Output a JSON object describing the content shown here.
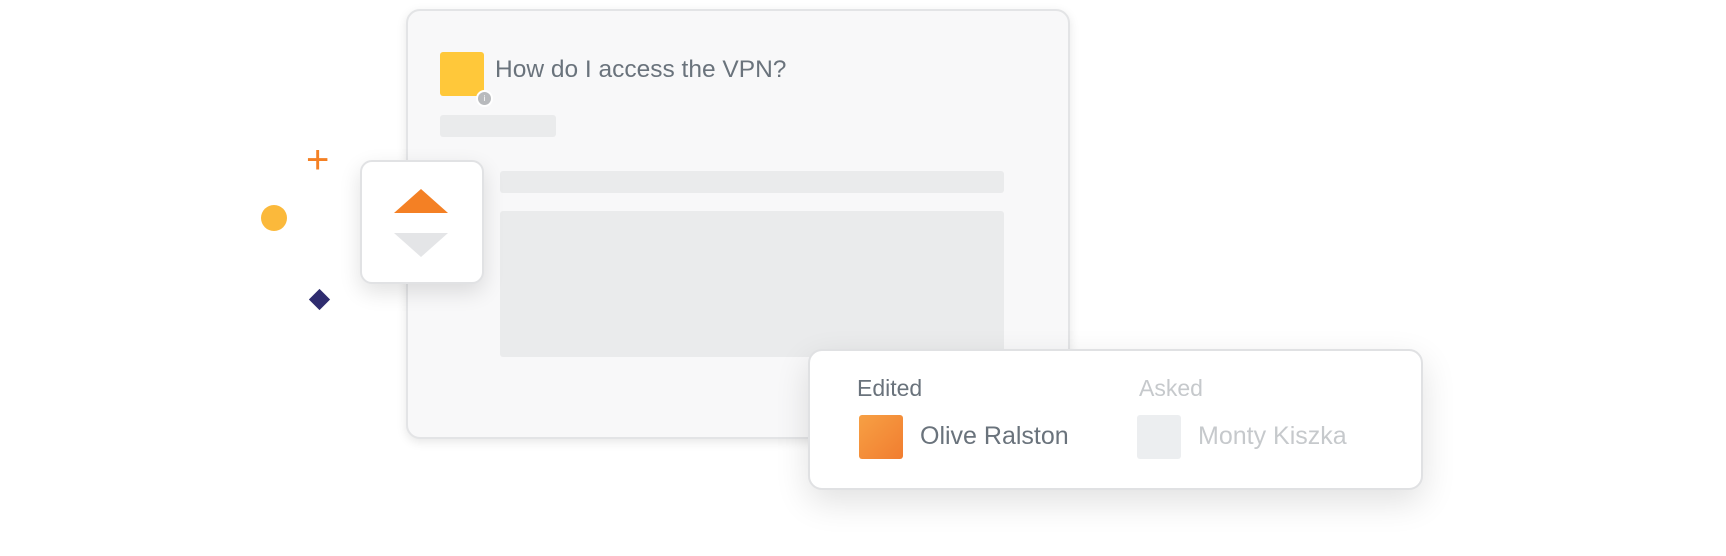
{
  "question": {
    "title": "How do I access the VPN?",
    "avatar_badge": "i"
  },
  "vote": {
    "up_icon": "triangle-up-icon",
    "down_icon": "triangle-down-icon",
    "up_color": "#f48024",
    "down_color": "#e4e5e7"
  },
  "attribution": {
    "edited": {
      "label": "Edited",
      "user": "Olive Ralston",
      "avatar_color": "#f48024"
    },
    "asked": {
      "label": "Asked",
      "user": "Monty Kiszka",
      "avatar_color": "#eceef0"
    }
  },
  "decorations": {
    "plus_glyph": "+",
    "colors": {
      "plus": "#f48024",
      "circle": "#fbb93b",
      "diamond": "#2f2c6f"
    }
  }
}
